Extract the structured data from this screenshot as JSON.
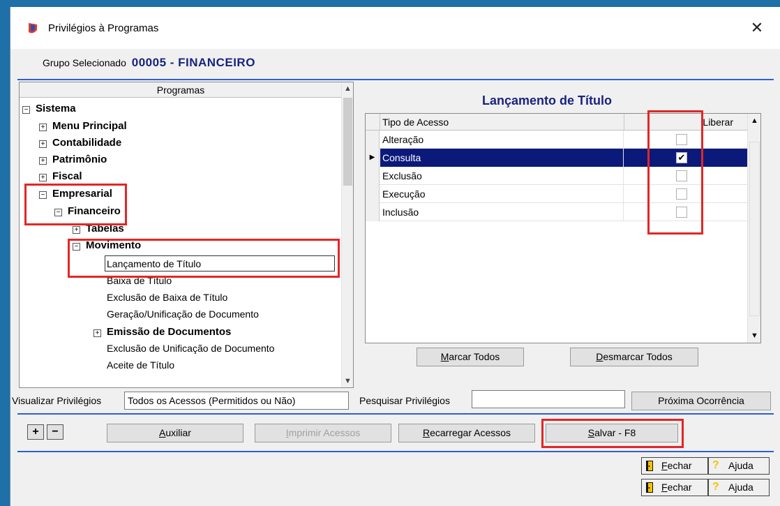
{
  "window": {
    "title": "Privilégios à Programas",
    "close_glyph": "✕",
    "icon": "app-icon"
  },
  "group": {
    "label": "Grupo Selecionado",
    "value": "00005 - FINANCEIRO"
  },
  "tree": {
    "header": "Programas",
    "nodes": [
      {
        "label": "Sistema",
        "toggle": "−"
      },
      {
        "label": "Menu Principal",
        "toggle": "+"
      },
      {
        "label": "Contabilidade",
        "toggle": "+"
      },
      {
        "label": "Patrimônio",
        "toggle": "+"
      },
      {
        "label": "Fiscal",
        "toggle": "+"
      },
      {
        "label": "Empresarial",
        "toggle": "−"
      },
      {
        "label": "Financeiro",
        "toggle": "−"
      },
      {
        "label": "Tabelas",
        "toggle": "+"
      },
      {
        "label": "Movimento",
        "toggle": "−"
      },
      {
        "label": "Lançamento de Título"
      },
      {
        "label": "Baixa de Título"
      },
      {
        "label": "Exclusão de Baixa de Título"
      },
      {
        "label": "Geração/Unificação de Documento"
      },
      {
        "label": "Emissão de Documentos",
        "toggle": "+"
      },
      {
        "label": "Exclusão de Unificação de Documento"
      },
      {
        "label": "Aceite de Título"
      }
    ],
    "scroll_up": "▲",
    "scroll_down": "▼"
  },
  "access": {
    "title": "Lançamento de Título",
    "col_type": "Tipo de Acesso",
    "col_release": "Liberar",
    "rows": [
      {
        "label": "Alteração",
        "checked": ""
      },
      {
        "label": "Consulta",
        "checked": "✔",
        "indicator": "▶"
      },
      {
        "label": "Exclusão",
        "checked": ""
      },
      {
        "label": "Execução",
        "checked": ""
      },
      {
        "label": "Inclusão",
        "checked": ""
      }
    ],
    "scroll_up": "▲",
    "scroll_down": "▼",
    "mark_all_key": "M",
    "mark_all_rest": "arcar Todos",
    "unmark_all_key": "D",
    "unmark_all_rest": "esmarcar Todos"
  },
  "filters": {
    "view_label": "Visualizar Privilégios",
    "view_value": "Todos os Acessos (Permitidos ou Não)",
    "search_label": "Pesquisar Privilégios",
    "search_value": "",
    "next_button": "Próxima Ocorrência"
  },
  "footer": {
    "expand": "+",
    "collapse": "−",
    "aux_key": "A",
    "aux_rest": "uxiliar",
    "print_key": "I",
    "print_rest": "mprimir Acessos",
    "reload_key": "R",
    "reload_rest": "ecarregar Acessos",
    "save_key": "S",
    "save_rest": "alvar - F8"
  },
  "bottom": {
    "close_key": "F",
    "close_rest": "echar",
    "help": "Ajuda",
    "help_glyph": "?"
  },
  "colors": {
    "accent": "#1a237e",
    "highlight": "#e32626",
    "selection": "#0b1a7a"
  }
}
